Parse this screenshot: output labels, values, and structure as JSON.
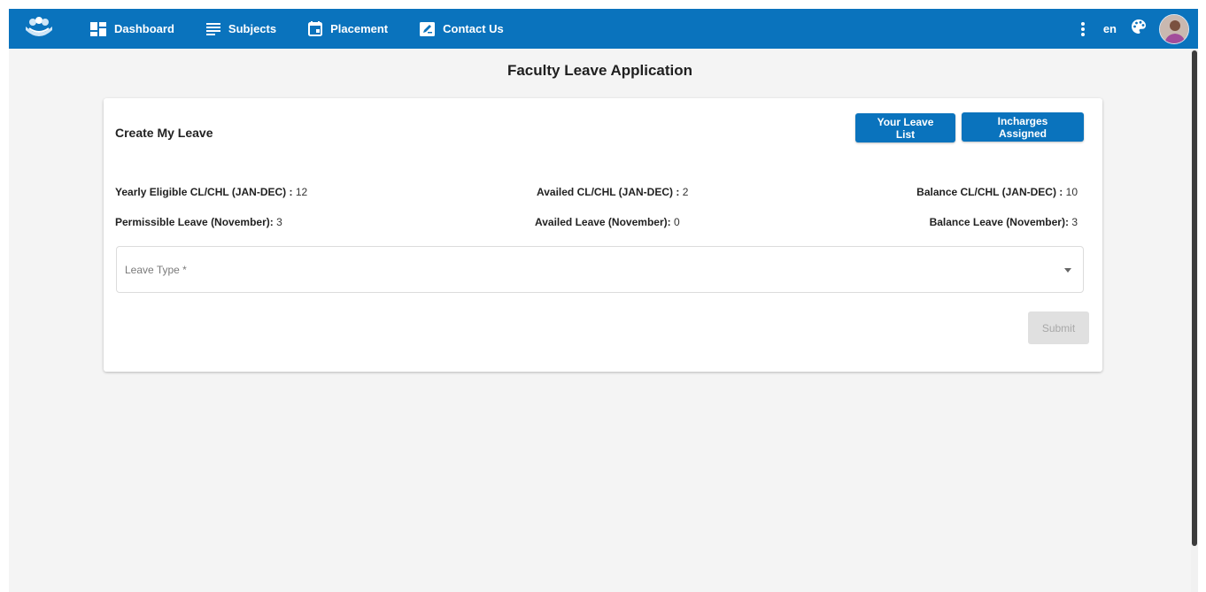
{
  "nav": {
    "items": [
      {
        "label": "Dashboard",
        "icon": "dashboard-icon"
      },
      {
        "label": "Subjects",
        "icon": "list-icon"
      },
      {
        "label": "Placement",
        "icon": "calendar-icon"
      },
      {
        "label": "Contact Us",
        "icon": "edit-icon"
      }
    ],
    "lang": "en"
  },
  "page": {
    "title": "Faculty Leave Application"
  },
  "card": {
    "title": "Create My Leave",
    "buttons": {
      "leave_list": "Your Leave List",
      "incharges": "Incharges Assigned"
    },
    "stats": [
      {
        "label": "Yearly Eligible CL/CHL (JAN-DEC) :",
        "value": "12"
      },
      {
        "label": "Availed CL/CHL (JAN-DEC) :",
        "value": "2"
      },
      {
        "label": "Balance CL/CHL (JAN-DEC) :",
        "value": "10"
      },
      {
        "label": "Permissible Leave (November):",
        "value": "3"
      },
      {
        "label": "Availed Leave (November):",
        "value": "0"
      },
      {
        "label": "Balance Leave (November):",
        "value": "3"
      }
    ],
    "leave_type_label": "Leave Type *",
    "submit": "Submit"
  },
  "colors": {
    "primary": "#0a73bd",
    "background": "#f4f4f4"
  }
}
